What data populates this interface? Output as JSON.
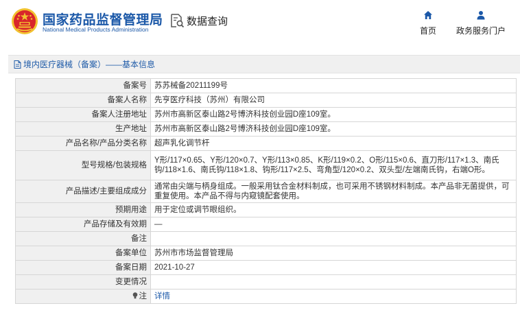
{
  "header": {
    "title_cn": "国家药品监督管理局",
    "title_en": "National Medical Products Administration",
    "query_label": "数据查询",
    "nav": [
      {
        "label": "首页",
        "icon": "home-icon"
      },
      {
        "label": "政务服务门户",
        "icon": "user-icon"
      }
    ]
  },
  "breadcrumb": {
    "icon": "document-icon",
    "text": "境内医疗器械（备案）——基本信息"
  },
  "record": {
    "rows": [
      {
        "label": "备案号",
        "value": "苏苏械备20211199号"
      },
      {
        "label": "备案人名称",
        "value": "先亨医疗科技（苏州）有限公司"
      },
      {
        "label": "备案人注册地址",
        "value": "苏州市高新区泰山路2号博济科技创业园D座109室。"
      },
      {
        "label": "生产地址",
        "value": "苏州市高新区泰山路2号博济科技创业园D座109室。"
      },
      {
        "label": "产品名称/产品分类名称",
        "value": "超声乳化调节杆"
      },
      {
        "label": "型号规格/包装规格",
        "value": "Y形/117×0.65、Y形/120×0.7、Y形/113×0.85、K形/119×0.2、O形/115×0.6、直刀形/117×1.3、南氏钩/118×1.6、南氏钩/118×1.8、钩形/117×2.5、弯角型/120×0.2、双头型/左端南氏钩，右端O形。"
      },
      {
        "label": "产品描述/主要组成成分",
        "value": "通常由尖端与柄身组成。一般采用钛合金材料制成，也可采用不锈钢材料制成。本产品非无菌提供，可重复使用。本产品不得与内窥镜配套使用。"
      },
      {
        "label": "预期用途",
        "value": "用于定位或调节眼组织。"
      },
      {
        "label": "产品存储及有效期",
        "value": "—"
      },
      {
        "label": "备注",
        "value": ""
      },
      {
        "label": "备案单位",
        "value": "苏州市市场监督管理局"
      },
      {
        "label": "备案日期",
        "value": "2021-10-27"
      },
      {
        "label": "变更情况",
        "value": ""
      }
    ],
    "note_label": "注",
    "note_icon": "lightbulb-icon",
    "note_link": "详情"
  },
  "colors": {
    "brand_blue": "#1b58a8",
    "emblem_red": "#d8262b",
    "emblem_gold": "#f2c230",
    "label_bg": "#f0f0f0",
    "border": "#d6d6d6"
  }
}
